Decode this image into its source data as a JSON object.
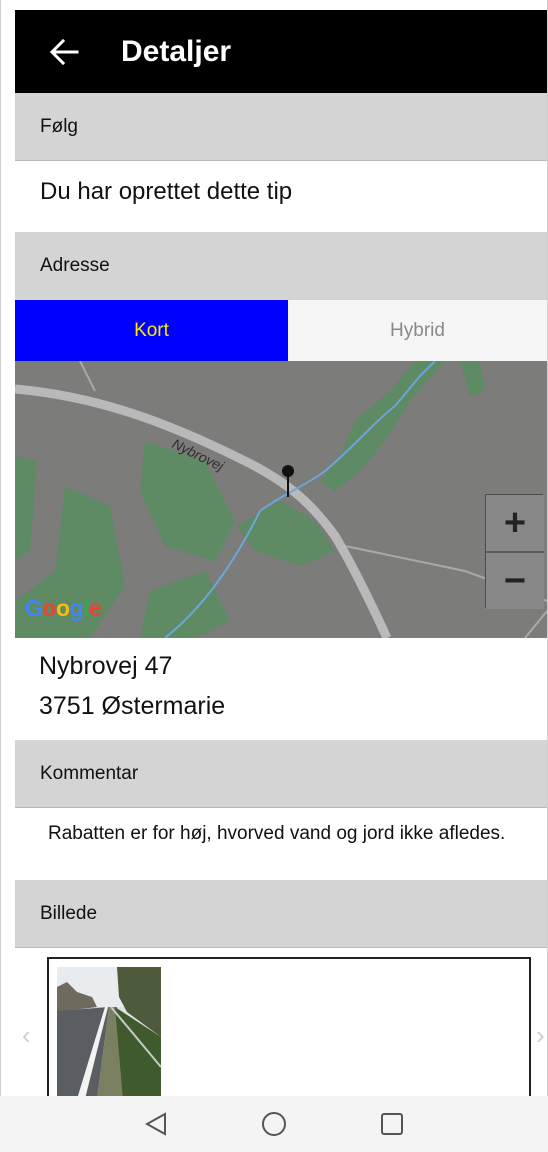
{
  "header": {
    "title": "Detaljer",
    "back_icon": "arrow-left-icon"
  },
  "follow": {
    "header": "Følg",
    "text": "Du har oprettet dette tip"
  },
  "address": {
    "header": "Adresse",
    "map_tabs": [
      {
        "label": "Kort",
        "active": true
      },
      {
        "label": "Hybrid",
        "active": false
      }
    ],
    "map": {
      "road_label": "Nybrovej",
      "zoom_in": "+",
      "zoom_out": "−",
      "logo": [
        "G",
        "o",
        "o",
        "g",
        "l",
        "e"
      ],
      "logo_colors": [
        "#4285F4",
        "#EA4335",
        "#FBBC05",
        "#4285F4",
        "#34A853",
        "#EA4335"
      ]
    },
    "line1": "Nybrovej 47",
    "line2": "3751 Østermarie"
  },
  "comment": {
    "header": "Kommentar",
    "text": "Rabatten er for høj, hvorved vand og jord ikke afledes."
  },
  "image": {
    "header": "Billede",
    "prev": "‹",
    "next": "›"
  },
  "colors": {
    "appbar": "#000000",
    "active_tab_bg": "#0000FF",
    "active_tab_text": "#FFEB00",
    "section_bg": "#D4D4D4"
  },
  "navbar": [
    "back-triangle-icon",
    "home-circle-icon",
    "recents-square-icon"
  ]
}
